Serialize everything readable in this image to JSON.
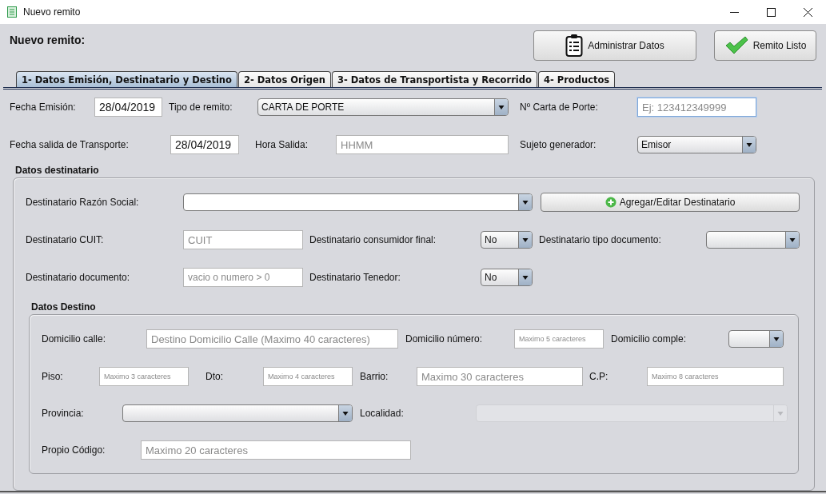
{
  "window": {
    "title": "Nuevo remito"
  },
  "heading": "Nuevo remito:",
  "actions": [
    {
      "label": "Administrar Datos",
      "kind": "clipboard"
    },
    {
      "label": "Remito Listo",
      "kind": "check"
    }
  ],
  "tabs": [
    {
      "label": "1- Datos Emisión, Destinatario y Destino",
      "selected": true
    },
    {
      "label": "2- Datos Origen",
      "selected": false
    },
    {
      "label": "3- Datos de Transportista y Recorrido",
      "selected": false
    },
    {
      "label": "4- Productos",
      "selected": false
    }
  ],
  "emision": {
    "fecha_emision": {
      "label": "Fecha Emisión:",
      "value": "28/04/2019"
    },
    "tipo_remito": {
      "label": "Tipo de remito:",
      "value": "CARTA DE PORTE"
    },
    "carta_porte": {
      "label": "Nº Carta de Porte:",
      "placeholder": "Ej: 123412349999",
      "focused": true
    },
    "fecha_salida": {
      "label": "Fecha salida de Transporte:",
      "value": "28/04/2019"
    },
    "hora_salida": {
      "label": "Hora Salida:",
      "placeholder": "HHMM"
    },
    "sujeto": {
      "label": "Sujeto generador:",
      "value": "Emisor"
    }
  },
  "destinatario": {
    "title": "Datos destinatario",
    "razon_social": {
      "label": "Destinatario Razón Social:"
    },
    "add_button": {
      "label": "Agregar/Editar Destinatario"
    },
    "cuit": {
      "label": "Destinatario CUIT:",
      "placeholder": "CUIT"
    },
    "consumidor_final": {
      "label": "Destinatario consumidor final:",
      "value": "No"
    },
    "tipo_documento": {
      "label": "Destinatario tipo documento:"
    },
    "documento": {
      "label": "Destinatario documento:",
      "placeholder": "vacio o numero > 0"
    },
    "tenedor": {
      "label": "Destinatario Tenedor:",
      "value": "No"
    }
  },
  "destino": {
    "title": "Datos Destino",
    "calle": {
      "label": "Domicilio calle:",
      "placeholder": "Destino Domicilio Calle (Maximo 40 caracteres)"
    },
    "numero": {
      "label": "Domicilio número:",
      "placeholder": "Maximo 5 caracteres"
    },
    "complemento": {
      "label": "Domicilio comple:"
    },
    "piso": {
      "label": "Piso:",
      "placeholder": "Maximo 3 caracteres"
    },
    "dto": {
      "label": "Dto:",
      "placeholder": "Maximo 4 caracteres"
    },
    "barrio": {
      "label": "Barrio:",
      "placeholder": "Maximo 30 caracteres"
    },
    "cp": {
      "label": "C.P:",
      "placeholder": "Maximo 8 caracteres"
    },
    "provincia": {
      "label": "Provincia:"
    },
    "localidad": {
      "label": "Localidad:",
      "disabled": true
    },
    "codigo": {
      "label": "Propio Código:",
      "placeholder": "Maximo 20 caracteres"
    }
  }
}
